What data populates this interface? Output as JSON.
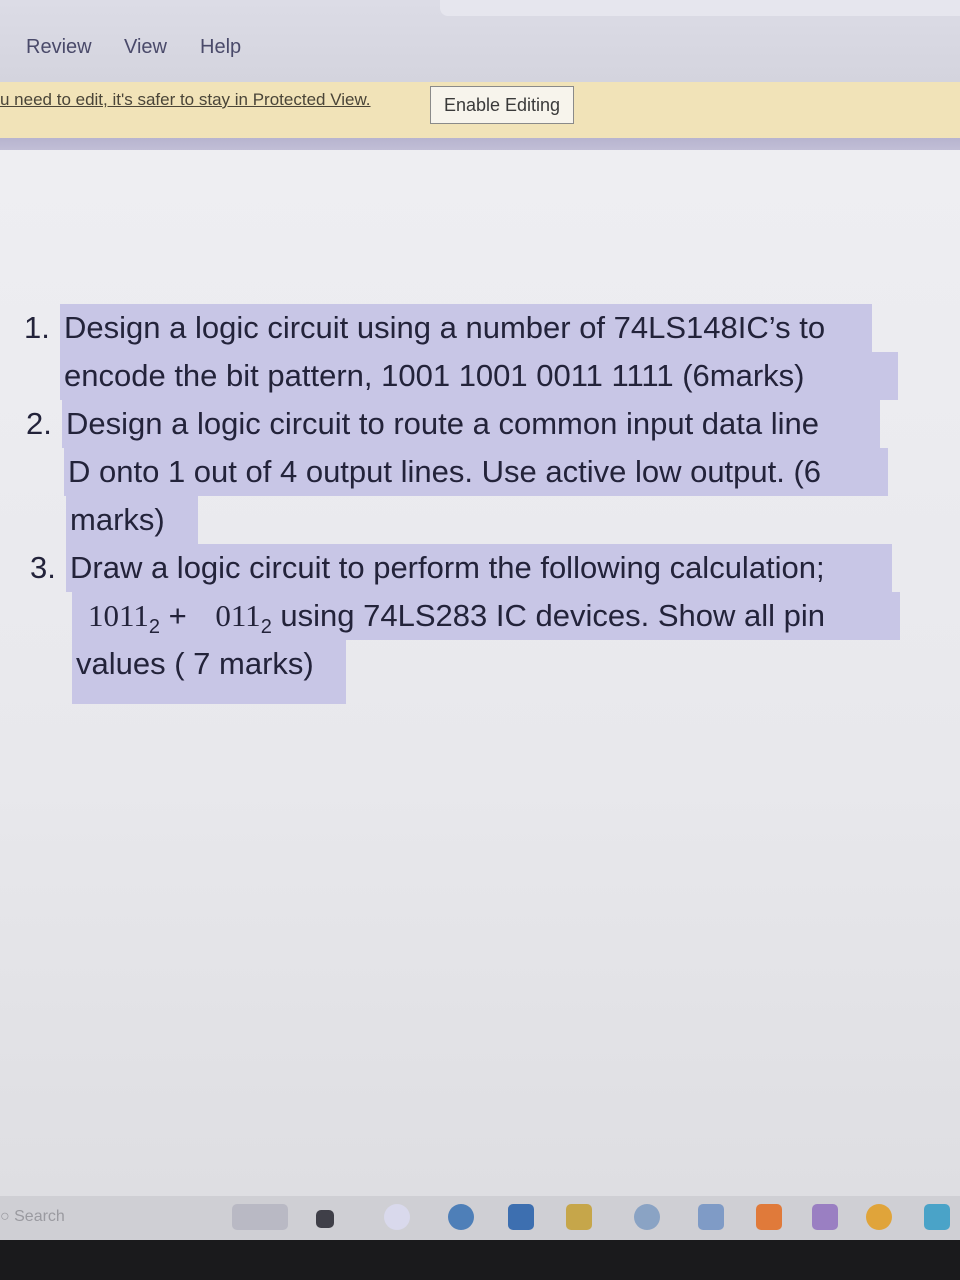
{
  "menu": {
    "review": "Review",
    "view": "View",
    "help": "Help"
  },
  "protected_view": {
    "message": "u need to edit, it's safer to stay in Protected View.",
    "enable_button": "Enable Editing"
  },
  "document": {
    "q1": {
      "number": "1.",
      "line1": "Design a logic circuit using a number of 74LS148IC’s to",
      "line2": "encode the bit pattern, 1001 1001 0011 1111  (6marks)"
    },
    "q2": {
      "number": "2.",
      "line1": "Design a logic circuit to route a common input data line",
      "line2": "D onto 1 out of 4 output lines. Use active low output. (6",
      "line3": "marks)"
    },
    "q3": {
      "number": "3.",
      "line1": "Draw a logic circuit to perform the following calculation;",
      "term1": "1011",
      "base1": "2",
      "plus": " + ",
      "term2": "011",
      "base2": "2",
      "line2_rest": " using 74LS283 IC devices. Show all pin",
      "line3": "values ( 7 marks)"
    }
  },
  "taskbar": {
    "search_placeholder": "Search"
  },
  "colors": {
    "highlight": "#c8c6e6",
    "protected_bar": "#f1e3b8",
    "text": "#23233a"
  }
}
